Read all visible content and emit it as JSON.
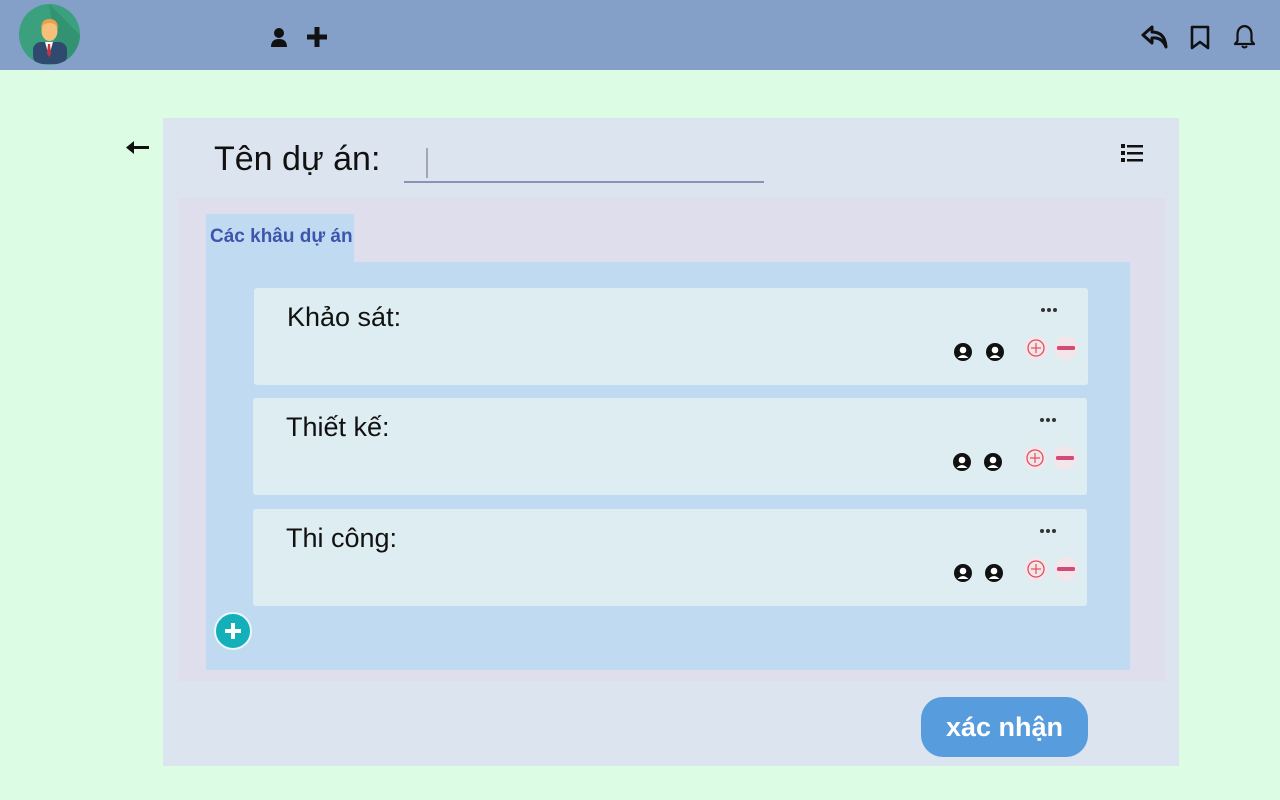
{
  "topbar": {
    "avatar_icon": "user-avatar-icon",
    "icons_left": [
      "person-icon",
      "plus-icon"
    ],
    "icons_right": [
      "reply-icon",
      "bookmark-icon",
      "bell-icon"
    ],
    "colors": {
      "bar": "#84a0c8"
    }
  },
  "form": {
    "title_label": "Tên dự án:",
    "name_value": "",
    "list_icon": "list-icon",
    "back_icon": "arrow-left-icon"
  },
  "section": {
    "tab_label": "Các khâu dự án",
    "stages": [
      {
        "title": "Khảo sát:"
      },
      {
        "title": "Thiết kế:"
      },
      {
        "title": "Thi công:"
      }
    ]
  },
  "actions": {
    "confirm_label": "xác nhận"
  },
  "colors": {
    "page_bg": "#dcfde3",
    "panel_bg": "#dce5ef",
    "tab_text": "#3e55ad",
    "confirm_bg": "#579cdc",
    "add_bg": "#13b0b9"
  }
}
